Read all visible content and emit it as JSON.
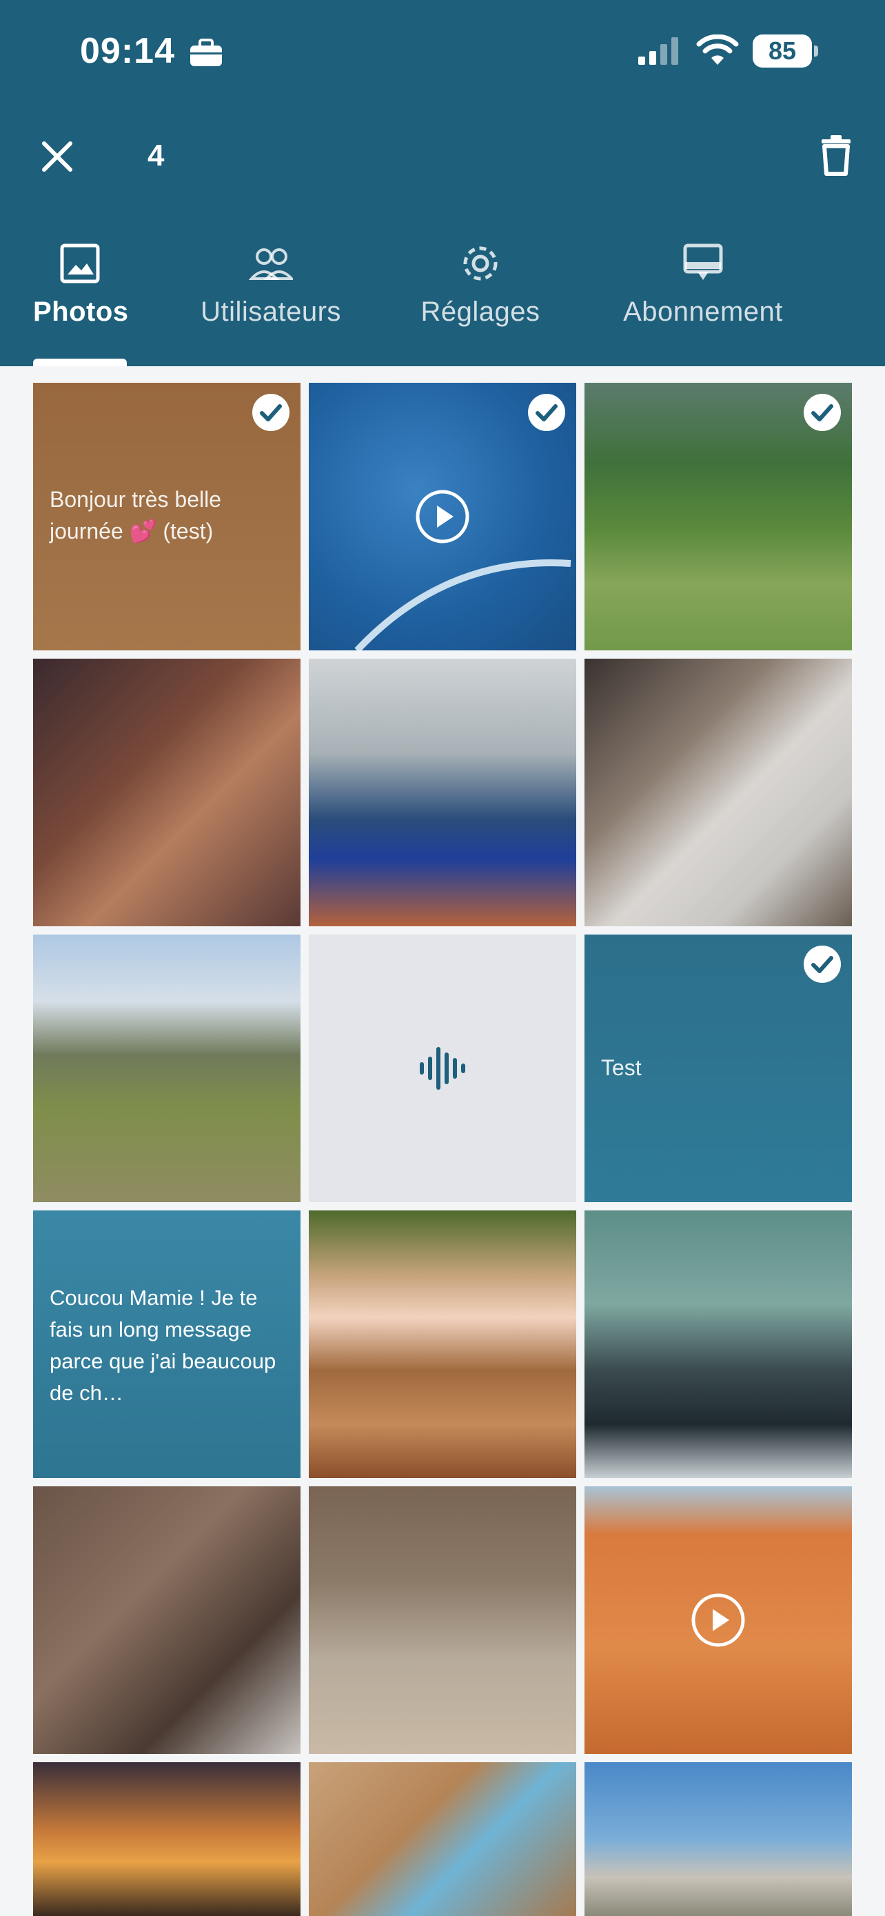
{
  "status_bar": {
    "time": "09:14",
    "battery": "85",
    "icons": [
      "briefcase-icon",
      "cellular-signal-icon",
      "wifi-icon",
      "battery-icon"
    ]
  },
  "toolbar": {
    "selected_count": "4",
    "icons": [
      "close-icon",
      "trash-icon"
    ]
  },
  "tabs": [
    {
      "label": "Photos",
      "icon": "image-icon",
      "active": true
    },
    {
      "label": "Utilisateurs",
      "icon": "users-icon",
      "active": false
    },
    {
      "label": "Réglages",
      "icon": "gear-icon",
      "active": false
    },
    {
      "label": "Abonnement",
      "icon": "frame-icon",
      "active": false
    }
  ],
  "colors": {
    "primary": "#1e5f7b",
    "accent_teal": "#2e7891",
    "background": "#f4f5f7",
    "white": "#ffffff"
  },
  "grid": {
    "items": [
      {
        "type": "text",
        "text": "Bonjour très belle journée 💕 (test)",
        "selected": true
      },
      {
        "type": "video",
        "description": "sea water video",
        "selected": true
      },
      {
        "type": "photo",
        "description": "hillside landscape",
        "selected": true
      },
      {
        "type": "photo",
        "description": "group selfie in restaurant",
        "selected": false
      },
      {
        "type": "photo",
        "description": "man at exhibition stand",
        "selected": false
      },
      {
        "type": "photo",
        "description": "digital frame in box",
        "selected": false
      },
      {
        "type": "photo",
        "description": "child walking dog by river",
        "selected": false
      },
      {
        "type": "audio",
        "description": "audio message",
        "selected": false
      },
      {
        "type": "text",
        "text": "Test",
        "selected": true
      },
      {
        "type": "text",
        "text": "Coucou Mamie ! Je te fais un long message parce que j'ai beaucoup de ch…",
        "selected": false
      },
      {
        "type": "photo",
        "description": "cyclist racing",
        "selected": false
      },
      {
        "type": "photo",
        "description": "boat outboard motor on sea",
        "selected": false
      },
      {
        "type": "photo",
        "description": "cat close-up",
        "selected": false
      },
      {
        "type": "photo",
        "description": "penguins colony",
        "selected": false
      },
      {
        "type": "video",
        "description": "wooden table video",
        "selected": false
      },
      {
        "type": "photo",
        "description": "sunset bridge",
        "selected": false
      },
      {
        "type": "photo",
        "description": "desk with notes",
        "selected": false
      },
      {
        "type": "photo",
        "description": "coastal rocks and house",
        "selected": false
      }
    ]
  }
}
